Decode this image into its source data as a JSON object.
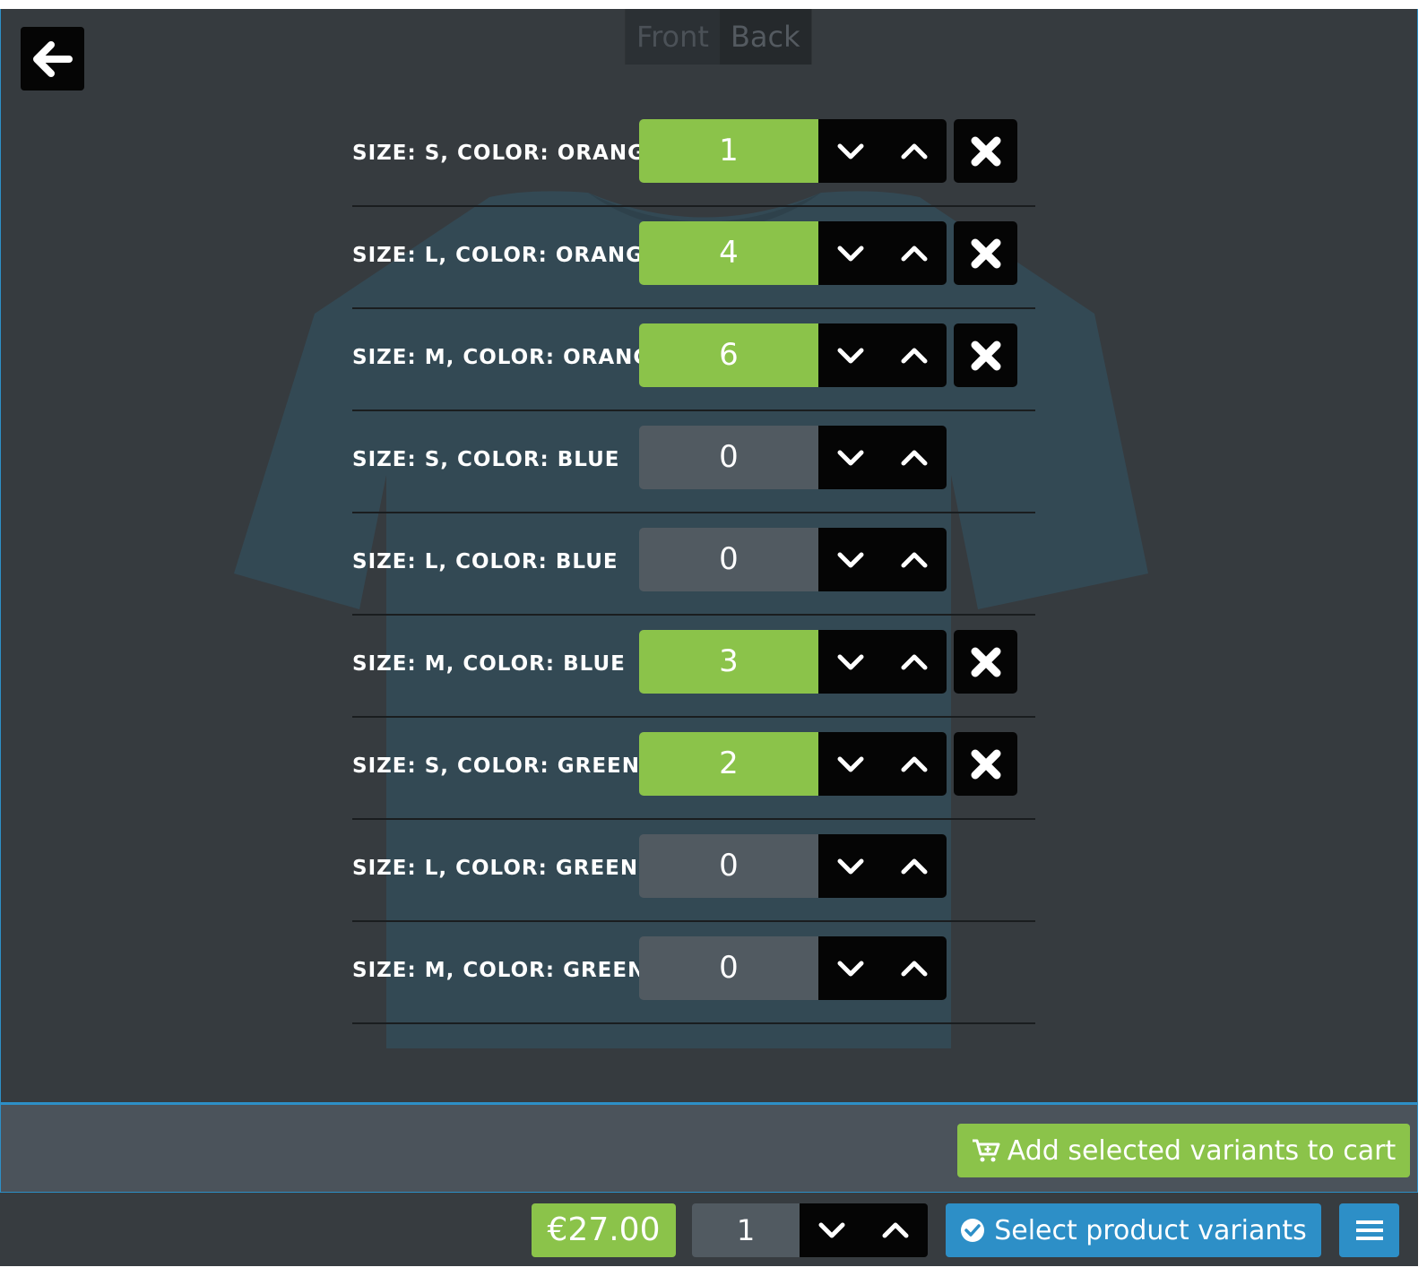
{
  "viewer": {
    "tabs": [
      {
        "label": "Front",
        "active": true
      },
      {
        "label": "Back",
        "active": false
      }
    ],
    "back_icon": "arrow-left-icon",
    "product_image": "t-shirt"
  },
  "variants": [
    {
      "label": "SIZE: S, COLOR: ORANGE",
      "quantity": "1",
      "selected": true
    },
    {
      "label": "SIZE: L, COLOR: ORANGE",
      "quantity": "4",
      "selected": true
    },
    {
      "label": "SIZE: M, COLOR: ORANGE",
      "quantity": "6",
      "selected": true
    },
    {
      "label": "SIZE: S, COLOR: BLUE",
      "quantity": "0",
      "selected": false
    },
    {
      "label": "SIZE: L, COLOR: BLUE",
      "quantity": "0",
      "selected": false
    },
    {
      "label": "SIZE: M, COLOR: BLUE",
      "quantity": "3",
      "selected": true
    },
    {
      "label": "SIZE: S, COLOR: GREEN",
      "quantity": "2",
      "selected": true
    },
    {
      "label": "SIZE: L, COLOR: GREEN",
      "quantity": "0",
      "selected": false
    },
    {
      "label": "SIZE: M, COLOR: GREEN",
      "quantity": "0",
      "selected": false
    }
  ],
  "action_bar": {
    "add_to_cart_label": "Add selected variants to cart",
    "add_to_cart_icon": "cart-plus-icon"
  },
  "bottom_bar": {
    "price": "€27.00",
    "quantity": "1",
    "select_variants_label": "Select product variants",
    "select_variants_icon": "check-circle-icon",
    "menu_icon": "menu-icon"
  },
  "colors": {
    "accent_green": "#8bc34a",
    "accent_blue": "#2d8fc7",
    "background": "#363b3f",
    "shirt": "#344a55"
  }
}
